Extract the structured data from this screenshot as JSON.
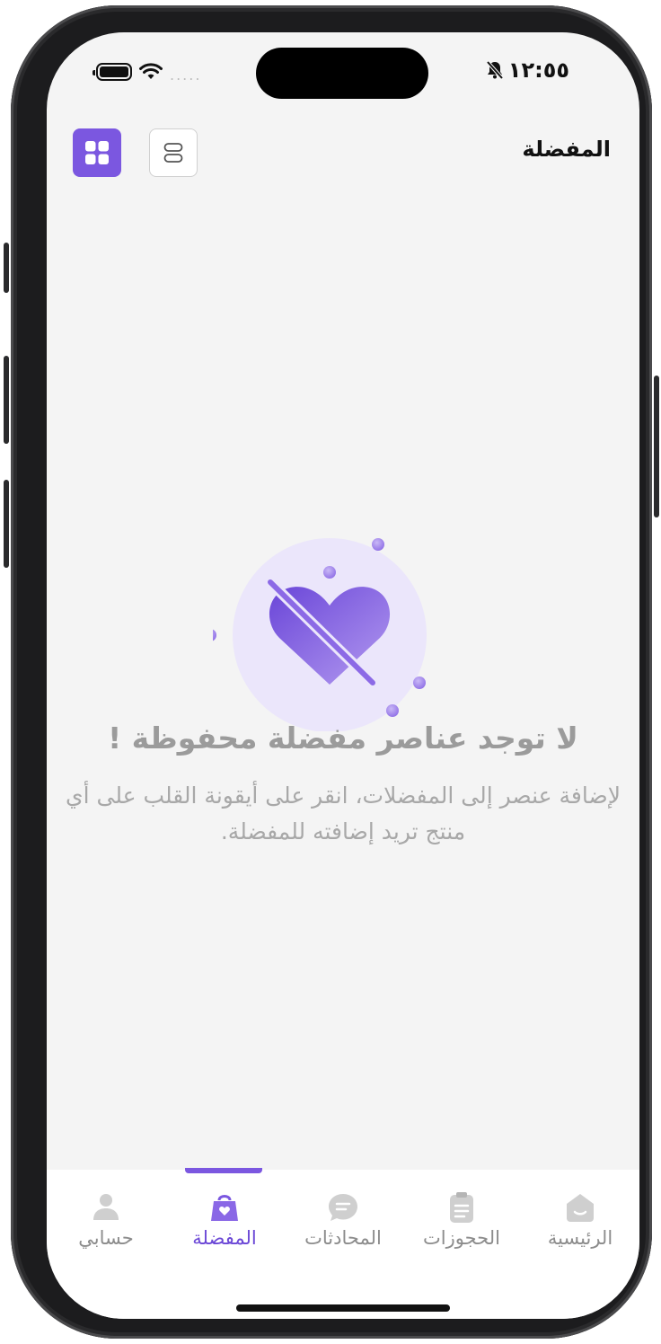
{
  "status_bar": {
    "time": "١٢:٥٥",
    "signal_dots": "....."
  },
  "header": {
    "title": "المفضلة"
  },
  "empty_state": {
    "title": "لا توجد عناصر مفضلة محفوظة !",
    "description": "لإضافة عنصر إلى المفضلات، انقر على أيقونة القلب على أي منتج تريد إضافته للمفضلة."
  },
  "tabs": [
    {
      "label": "الرئيسية",
      "icon": "home-icon"
    },
    {
      "label": "الحجوزات",
      "icon": "clipboard-icon"
    },
    {
      "label": "المحادثات",
      "icon": "chat-icon"
    },
    {
      "label": "المفضلة",
      "icon": "heart-bag-icon",
      "active": true
    },
    {
      "label": "حسابي",
      "icon": "person-icon"
    }
  ],
  "colors": {
    "accent": "#7b57e0",
    "background": "#f4f4f4",
    "muted_text": "#a8a8a8"
  }
}
